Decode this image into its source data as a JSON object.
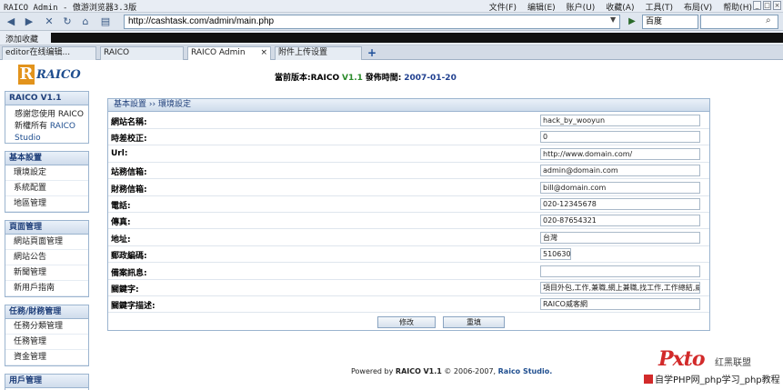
{
  "window": {
    "title": "RAICO Admin - 傲游浏览器3.3版"
  },
  "menu": [
    "文件(F)",
    "编辑(E)",
    "账户(U)",
    "收藏(A)",
    "工具(T)",
    "布局(V)",
    "帮助(H)"
  ],
  "address": {
    "url": "http://cashtask.com/admin/main.php"
  },
  "search": {
    "engine": "百度"
  },
  "favorites": {
    "label": "添加收藏"
  },
  "tabs": [
    {
      "label": "editor在线编辑..."
    },
    {
      "label": "RAICO"
    },
    {
      "label": "RAICO Admin"
    },
    {
      "label": "附件上传设置"
    }
  ],
  "brand": {
    "logo_letter": "R",
    "logo_text": "RAICO"
  },
  "version": {
    "label": "當前版本:",
    "name": "RAICO",
    "number": "V1.1",
    "date_label": "發佈時間:",
    "date": "2007-01-20"
  },
  "sidebar": {
    "intro": {
      "title": "RAICO V1.1",
      "line1": "感謝您使用 RAICO",
      "line2": "所有",
      "prefix": "新權",
      "studio": "RAICO Studio"
    },
    "sections": [
      {
        "title": "基本設置",
        "items": [
          "環境設定",
          "系統配置",
          "地區管理"
        ]
      },
      {
        "title": "頁面管理",
        "items": [
          "網站頁面管理",
          "網站公告",
          "新聞管理",
          "新用戶指南"
        ]
      },
      {
        "title": "任務/財務管理",
        "items": [
          "任務分類管理",
          "任務管理",
          "資金管理"
        ]
      },
      {
        "title": "用戶管理",
        "items": []
      }
    ]
  },
  "breadcrumb": {
    "root": "基本設置",
    "sep": "››",
    "current": "環境設定"
  },
  "form": {
    "rows": [
      {
        "label": "網站名稱:",
        "value": "hack_by_wooyun",
        "width": 176
      },
      {
        "label": "時差校正:",
        "value": "0",
        "width": 176
      },
      {
        "label": "Url:",
        "value": "http://www.domain.com/",
        "width": 176
      },
      {
        "label": "站務信箱:",
        "value": "admin@domain.com",
        "width": 176
      },
      {
        "label": "財務信箱:",
        "value": "bill@domain.com",
        "width": 176
      },
      {
        "label": "電話:",
        "value": "020-12345678",
        "width": 176
      },
      {
        "label": "傳真:",
        "value": "020-87654321",
        "width": 176
      },
      {
        "label": "地址:",
        "value": "台灣",
        "width": 176
      },
      {
        "label": "郵政編碼:",
        "value": "510630",
        "width": 34
      },
      {
        "label": "備案訊息:",
        "value": "",
        "width": 176
      },
      {
        "label": "關鍵字:",
        "value": "項目外包,工作,兼職,網上兼職,找工作,工作總結,威客",
        "width": 176
      },
      {
        "label": "關鍵字描述:",
        "value": "RAICO威客網",
        "width": 176
      }
    ],
    "submit_label": "修改",
    "reset_label": "重填"
  },
  "footer": {
    "prefix": "Powered by",
    "name": "RAICO",
    "version": "V1.1",
    "copy": "© 2006-2007,",
    "studio": "Raico Studio."
  },
  "watermark": {
    "logo": "Pxto",
    "brand": "红黑联盟",
    "slogan": "自学PHP网_php学习_php教程"
  }
}
